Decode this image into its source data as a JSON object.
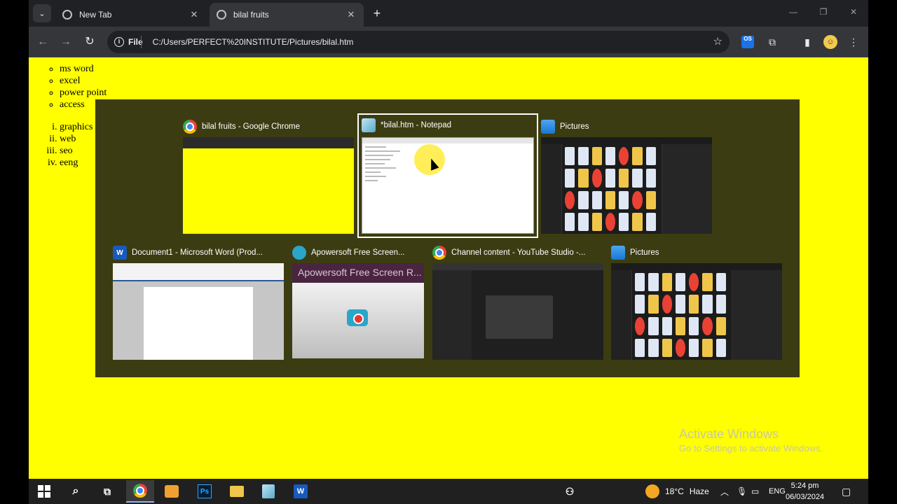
{
  "browser": {
    "tabs": [
      {
        "label": "New Tab",
        "active": false
      },
      {
        "label": "bilal fruits",
        "active": true
      }
    ],
    "omnibox": {
      "scheme": "File",
      "url": "C:/Users/PERFECT%20INSTITUTE/Pictures/bilal.htm"
    },
    "extension_label": "OS"
  },
  "page": {
    "unordered_list": [
      "ms word",
      "excel",
      "power point",
      "access"
    ],
    "ordered_list": [
      "graphics",
      "web",
      "seo",
      "eeng"
    ],
    "watermark": {
      "line1": "Activate Windows",
      "line2": "Go to Settings to activate Windows."
    }
  },
  "switcher": {
    "windows": [
      {
        "title": "bilal fruits - Google Chrome",
        "icon": "chrome-icon"
      },
      {
        "title": "*bilal.htm - Notepad",
        "icon": "notepad-icon",
        "selected": true
      },
      {
        "title": "Pictures",
        "icon": "pictures-icon"
      },
      {
        "title": "Document1 - Microsoft Word (Prod...",
        "icon": "word-icon",
        "icon_text": "W"
      },
      {
        "title": "Apowersoft Free Screen...",
        "icon": "apowersoft-icon",
        "thumb_header": "Apowersoft Free Screen R..."
      },
      {
        "title": "Channel content - YouTube Studio -...",
        "icon": "chrome-icon"
      },
      {
        "title": "Pictures",
        "icon": "pictures-icon"
      }
    ]
  },
  "taskbar": {
    "apps": [
      "Ps",
      "W"
    ],
    "weather": {
      "temp": "18°C",
      "condition": "Haze"
    },
    "language": "ENG",
    "time": "5:24 pm",
    "date": "06/03/2024"
  },
  "colors": {
    "page_background": "#ffff00",
    "switcher_background": "#3c3c12",
    "browser_frame": "#202124"
  }
}
